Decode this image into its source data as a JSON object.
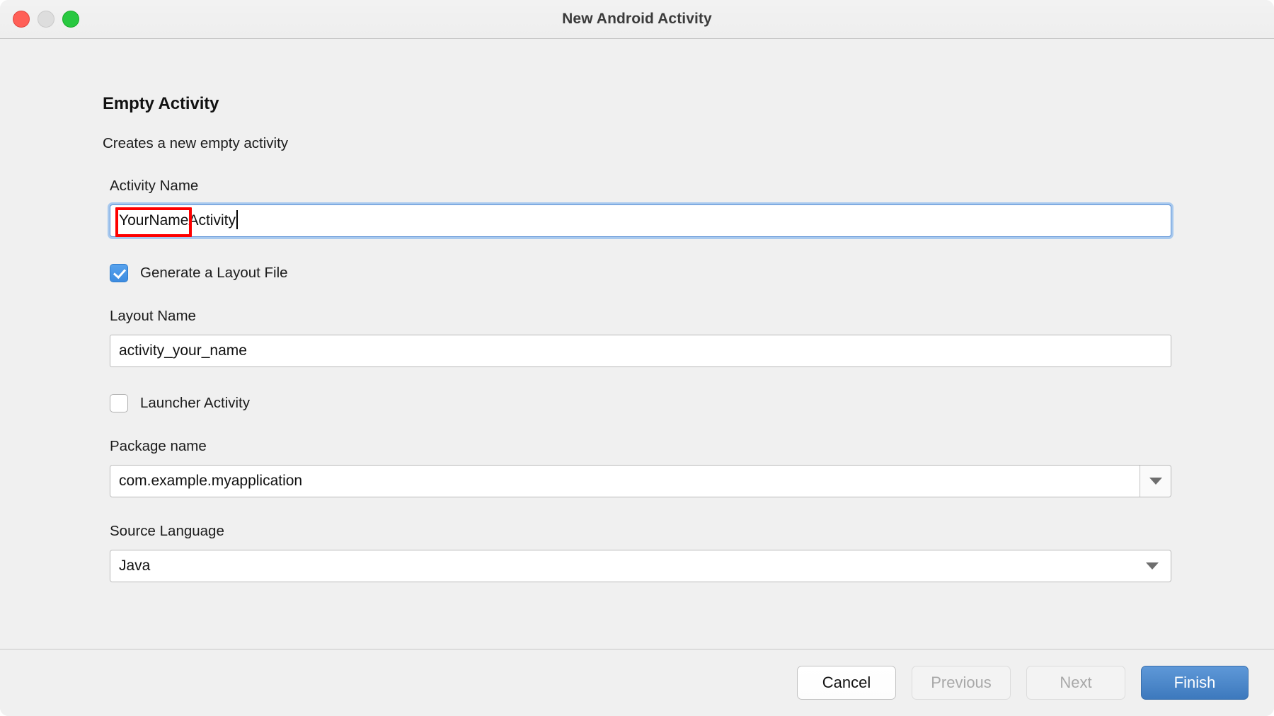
{
  "window": {
    "title": "New Android Activity",
    "traffic_lights": [
      {
        "name": "close",
        "color": "#ff5f57"
      },
      {
        "name": "minimize",
        "color": "#dddddd"
      },
      {
        "name": "zoom",
        "color": "#28c840"
      }
    ]
  },
  "step": {
    "title": "Empty Activity",
    "description": "Creates a new empty activity"
  },
  "fields": {
    "activity_name": {
      "label": "Activity Name",
      "value": "YourNameActivity",
      "highlighted_part": "YourName",
      "focused": true,
      "annotation_color": "#fe0000"
    },
    "generate_layout": {
      "label": "Generate a Layout File",
      "checked": true,
      "accent": "#3d8ce0"
    },
    "layout_name": {
      "label": "Layout Name",
      "value": "activity_your_name"
    },
    "launcher_activity": {
      "label": "Launcher Activity",
      "checked": false
    },
    "package_name": {
      "label": "Package name",
      "value": "com.example.myapplication",
      "arrow_icon": "chevron-down-icon"
    },
    "source_language": {
      "label": "Source Language",
      "value": "Java",
      "arrow_icon": "chevron-down-icon"
    }
  },
  "footer": {
    "cancel": "Cancel",
    "previous": "Previous",
    "next": "Next",
    "finish": "Finish",
    "primary_color": "#4a86c8"
  }
}
